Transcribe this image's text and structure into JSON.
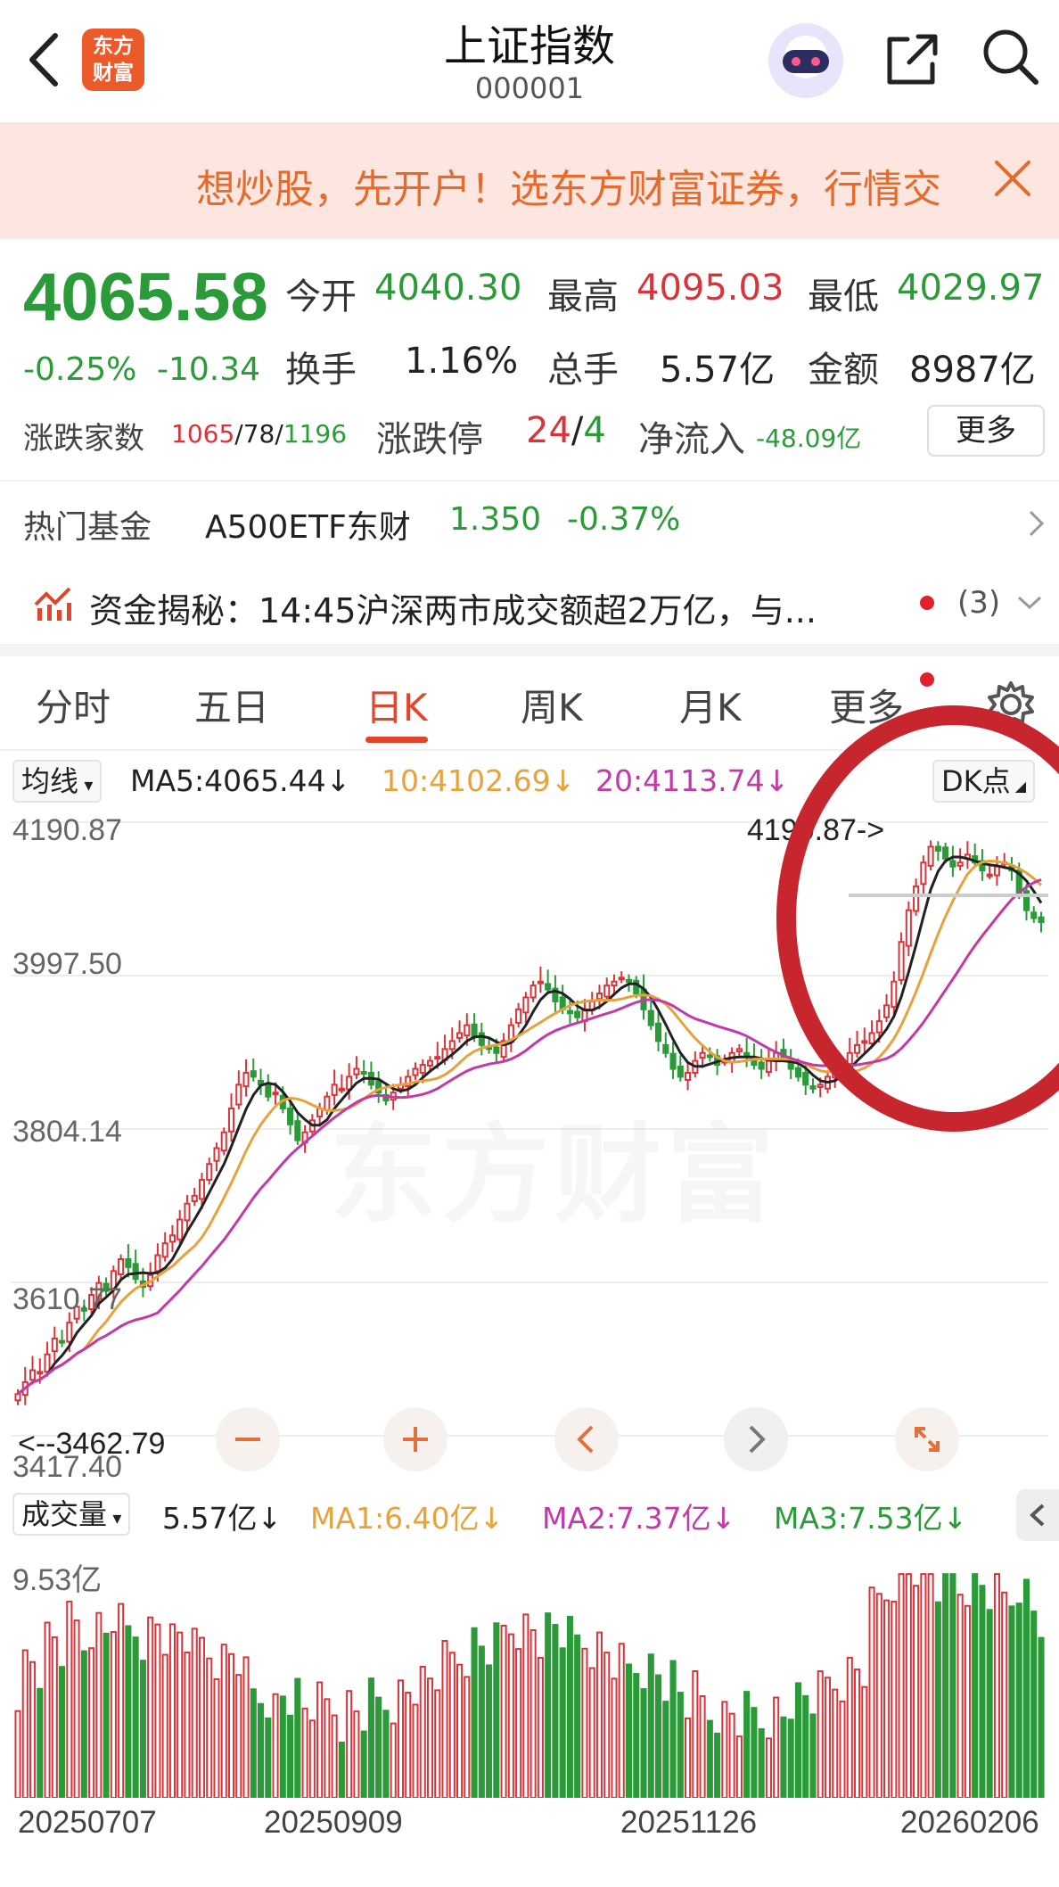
{
  "header": {
    "logo_line1": "东方",
    "logo_line2": "财富",
    "title": "上证指数",
    "code": "000001"
  },
  "banner": {
    "text": "想炒股，先开户！选东方财富证券，行情交"
  },
  "quote": {
    "price": "4065.58",
    "change_pct": "-0.25%",
    "change_abs": "-10.34",
    "open_label": "今开",
    "open": "4040.30",
    "high_label": "最高",
    "high": "4095.03",
    "low_label": "最低",
    "low": "4029.97",
    "turnover_label": "换手",
    "turnover": "1.16%",
    "volume_label": "总手",
    "volume": "5.57亿",
    "amount_label": "金额",
    "amount": "8987亿",
    "breadth_label": "涨跌家数",
    "breadth_up": "1065",
    "breadth_sep1": "/",
    "breadth_flat": "78",
    "breadth_sep2": "/",
    "breadth_down": "1196",
    "limit_label": "涨跌停",
    "limit_up": "24",
    "limit_sep": "/",
    "limit_down": "4",
    "netflow_label": "净流入",
    "netflow": "-48.09亿",
    "more_label": "更多"
  },
  "fund": {
    "label": "热门基金",
    "name": "A500ETF东财",
    "price": "1.350",
    "change": "-0.37%"
  },
  "news": {
    "text": "资金揭秘：14:45沪深两市成交额超2万亿，与...",
    "count": "(3)"
  },
  "tabs": [
    "分时",
    "五日",
    "日K",
    "周K",
    "月K",
    "更多"
  ],
  "active_tab": "日K",
  "ma_row": {
    "select": "均线",
    "ma5": "MA5:4065.44↓",
    "ma10": "10:4102.69↓",
    "ma20": "20:4113.74↓",
    "dk": "DK点",
    "colors": {
      "ma5": "#222222",
      "ma10": "#e8a23c",
      "ma20": "#c23aa8"
    }
  },
  "price_axis": [
    "4190.87",
    "3997.50",
    "3804.14",
    "3610.77",
    "3417.40"
  ],
  "callouts": {
    "high": "4190.87->",
    "low": "<--3462.79"
  },
  "volume_row": {
    "select": "成交量",
    "vol": "5.57亿↓",
    "ma1": "MA1:6.40亿↓",
    "ma2": "MA2:7.37亿↓",
    "ma3": "MA3:7.53亿↓",
    "max": "9.53亿"
  },
  "x_axis": [
    "20250707",
    "20250909",
    "20251126",
    "20260206"
  ],
  "watermark": "东方财富",
  "colors": {
    "up": "#d9343a",
    "down": "#2b9a39",
    "accent": "#e0462c",
    "annotation_circle": "#c8262e"
  },
  "chart_data": {
    "type": "candlestick",
    "period": "daily",
    "y_range": [
      3417.4,
      4190.87
    ],
    "y_ticks": [
      4190.87,
      3997.5,
      3804.14,
      3610.77,
      3417.4
    ],
    "x_ticks": [
      "20250707",
      "20250909",
      "20251126",
      "20260206"
    ],
    "period_high": 4190.87,
    "period_low": 3462.79,
    "close_series": [
      3470,
      3485,
      3500,
      3498,
      3520,
      3540,
      3535,
      3560,
      3580,
      3575,
      3595,
      3610,
      3600,
      3625,
      3640,
      3630,
      3615,
      3605,
      3620,
      3645,
      3660,
      3670,
      3690,
      3710,
      3720,
      3740,
      3760,
      3780,
      3800,
      3830,
      3860,
      3875,
      3870,
      3860,
      3845,
      3850,
      3830,
      3810,
      3790,
      3800,
      3815,
      3830,
      3845,
      3860,
      3855,
      3870,
      3880,
      3875,
      3860,
      3850,
      3840,
      3850,
      3860,
      3870,
      3880,
      3885,
      3890,
      3895,
      3905,
      3915,
      3925,
      3935,
      3920,
      3910,
      3905,
      3900,
      3915,
      3935,
      3955,
      3970,
      3985,
      3990,
      3980,
      3965,
      3955,
      3950,
      3945,
      3955,
      3965,
      3975,
      3985,
      3990,
      3995,
      3990,
      3975,
      3955,
      3935,
      3915,
      3900,
      3880,
      3870,
      3875,
      3890,
      3900,
      3895,
      3885,
      3890,
      3900,
      3905,
      3895,
      3885,
      3880,
      3890,
      3900,
      3895,
      3880,
      3870,
      3860,
      3855,
      3860,
      3870,
      3880,
      3890,
      3900,
      3910,
      3915,
      3925,
      3940,
      3960,
      3990,
      4040,
      4080,
      4110,
      4140,
      4160,
      4155,
      4145,
      4135,
      4140,
      4150,
      4140,
      4130,
      4125,
      4135,
      4140,
      4130,
      4100,
      4080,
      4070,
      4065
    ],
    "ma_lines": [
      {
        "name": "MA5",
        "last": 4065.44
      },
      {
        "name": "MA10",
        "last": 4102.69
      },
      {
        "name": "MA20",
        "last": 4113.74
      }
    ],
    "volume": {
      "last": "5.57亿",
      "max": "9.53亿",
      "ma1": "6.40亿",
      "ma2": "7.37亿",
      "ma3": "7.53亿"
    }
  }
}
